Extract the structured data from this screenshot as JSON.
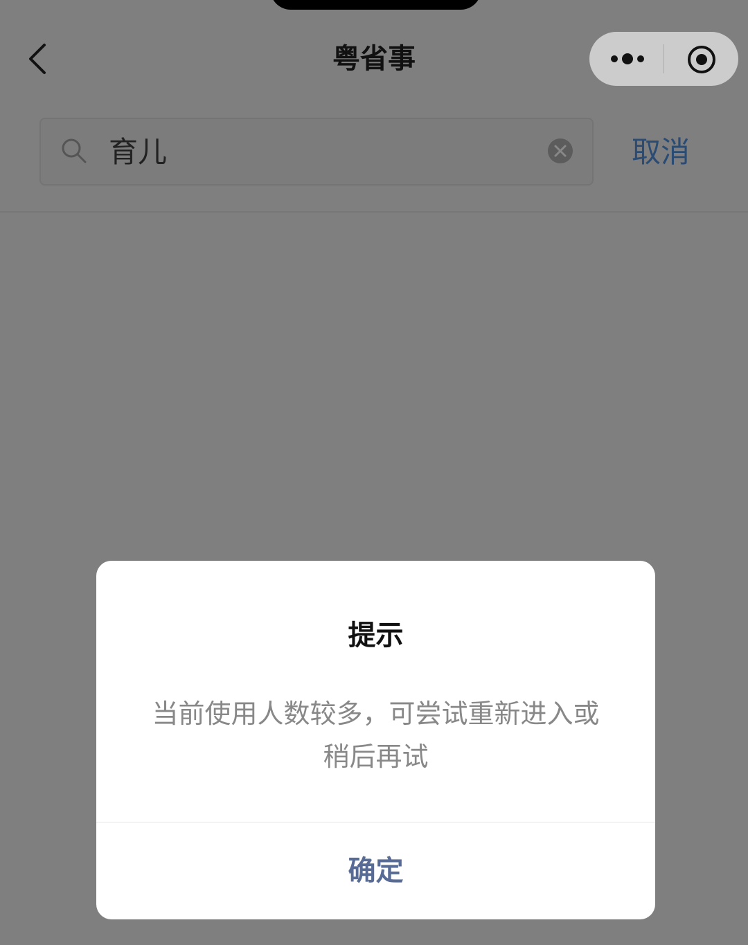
{
  "navbar": {
    "title": "粤省事"
  },
  "search": {
    "query": "育儿",
    "cancel_label": "取消"
  },
  "dialog": {
    "title": "提示",
    "message": "当前使用人数较多，可尝试重新进入或稍后再试",
    "confirm_label": "确定"
  },
  "icons": {
    "back": "chevron-left-icon",
    "more": "more-dots-icon",
    "close_miniprogram": "target-circle-icon",
    "search": "search-icon",
    "clear": "clear-icon"
  },
  "colors": {
    "overlay": "#7f7f7f",
    "link": "#576b95",
    "cancel": "#2a4c74"
  }
}
